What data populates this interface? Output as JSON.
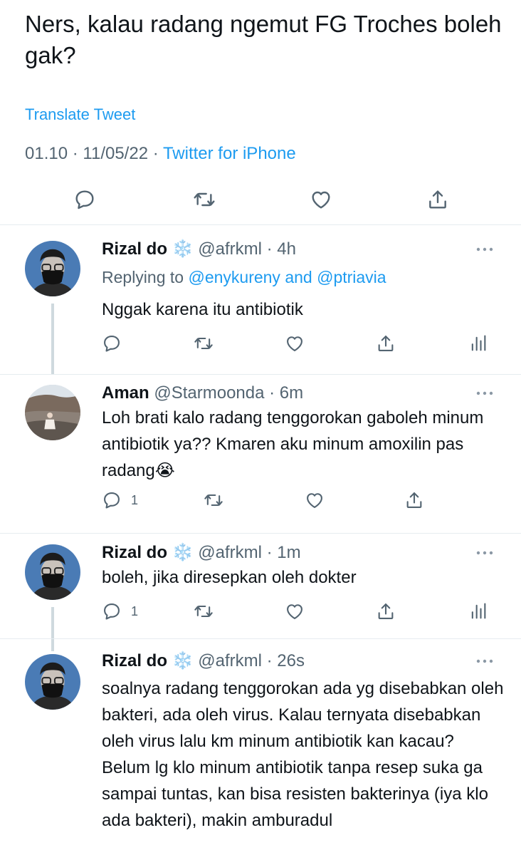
{
  "main_tweet": {
    "text": "Ners, kalau radang ngemut FG Troches boleh gak?",
    "translate_label": "Translate Tweet",
    "time": "01.10",
    "date": "11/05/22",
    "source": "Twitter for iPhone"
  },
  "actions": {
    "reply_icon": "reply-icon",
    "retweet_icon": "retweet-icon",
    "like_icon": "like-icon",
    "share_icon": "share-icon",
    "analytics_icon": "analytics-icon",
    "more_icon": "more-icon"
  },
  "colors": {
    "link": "#1d9bf0",
    "secondary_text": "#536471",
    "divider": "#e6ecf0",
    "thread_line": "#cfd9de"
  },
  "replies": [
    {
      "name": "Rizal do",
      "badge": "❄️",
      "handle": "@afrkml",
      "time": "4h",
      "replying_label": "Replying to",
      "mention1": "@enykureny",
      "and": "and",
      "mention2": "@ptriavia",
      "text": "Nggak karena itu antibiotik"
    },
    {
      "name": "Aman",
      "handle": "@Starmoonda",
      "time": "6m",
      "text": "Loh brati kalo radang tenggorokan gaboleh minum antibiotik ya?? Kmaren aku minum amoxilin pas radang😭",
      "reply_count": "1"
    },
    {
      "name": "Rizal do",
      "badge": "❄️",
      "handle": "@afrkml",
      "time": "1m",
      "text": "boleh, jika diresepkan oleh dokter",
      "reply_count": "1"
    },
    {
      "name": "Rizal do",
      "badge": "❄️",
      "handle": "@afrkml",
      "time": "26s",
      "text": "soalnya radang tenggorokan ada yg disebabkan oleh bakteri, ada oleh virus. Kalau ternyata disebabkan oleh virus lalu km minum antibiotik kan kacau? Belum lg klo minum antibiotik tanpa resep suka ga sampai tuntas, kan bisa resisten bakterinya (iya klo ada bakteri), makin amburadul"
    }
  ]
}
